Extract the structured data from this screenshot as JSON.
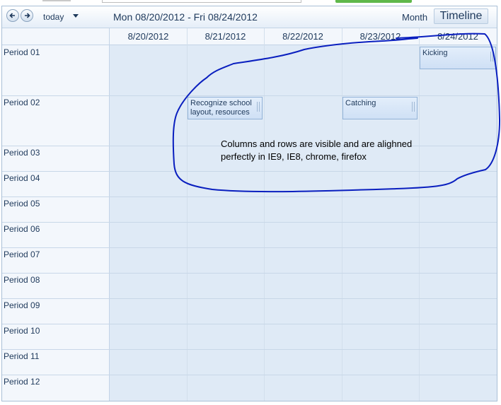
{
  "toolbar": {
    "today_label": "today",
    "date_range": "Mon 08/20/2012 - Fri 08/24/2012",
    "views": {
      "month": "Month",
      "timeline": "Timeline",
      "selected": "Timeline"
    }
  },
  "days": [
    "8/20/2012",
    "8/21/2012",
    "8/22/2012",
    "8/23/2012",
    "8/24/2012"
  ],
  "periods": [
    "Period 01",
    "Period 02",
    "Period 03",
    "Period 04",
    "Period 05",
    "Period 06",
    "Period 07",
    "Period 08",
    "Period 09",
    "Period 10",
    "Period 11",
    "Period 12"
  ],
  "appointments": [
    {
      "title": "Kicking",
      "day": "8/24/2012",
      "period": "Period 01"
    },
    {
      "title": "Recognize school layout, resources",
      "day": "8/21/2012",
      "period": "Period 02"
    },
    {
      "title": "Catching",
      "day": "8/23/2012",
      "period": "Period 02"
    }
  ],
  "annotation": {
    "text": "Columns and rows are visible and are alighned perfectly in IE9, IE8, chrome, firefox",
    "color": "#0000cc"
  },
  "colors": {
    "accent": "#1e395b",
    "grid": "#dfeaf6",
    "appointment": "#cfe0f5"
  }
}
